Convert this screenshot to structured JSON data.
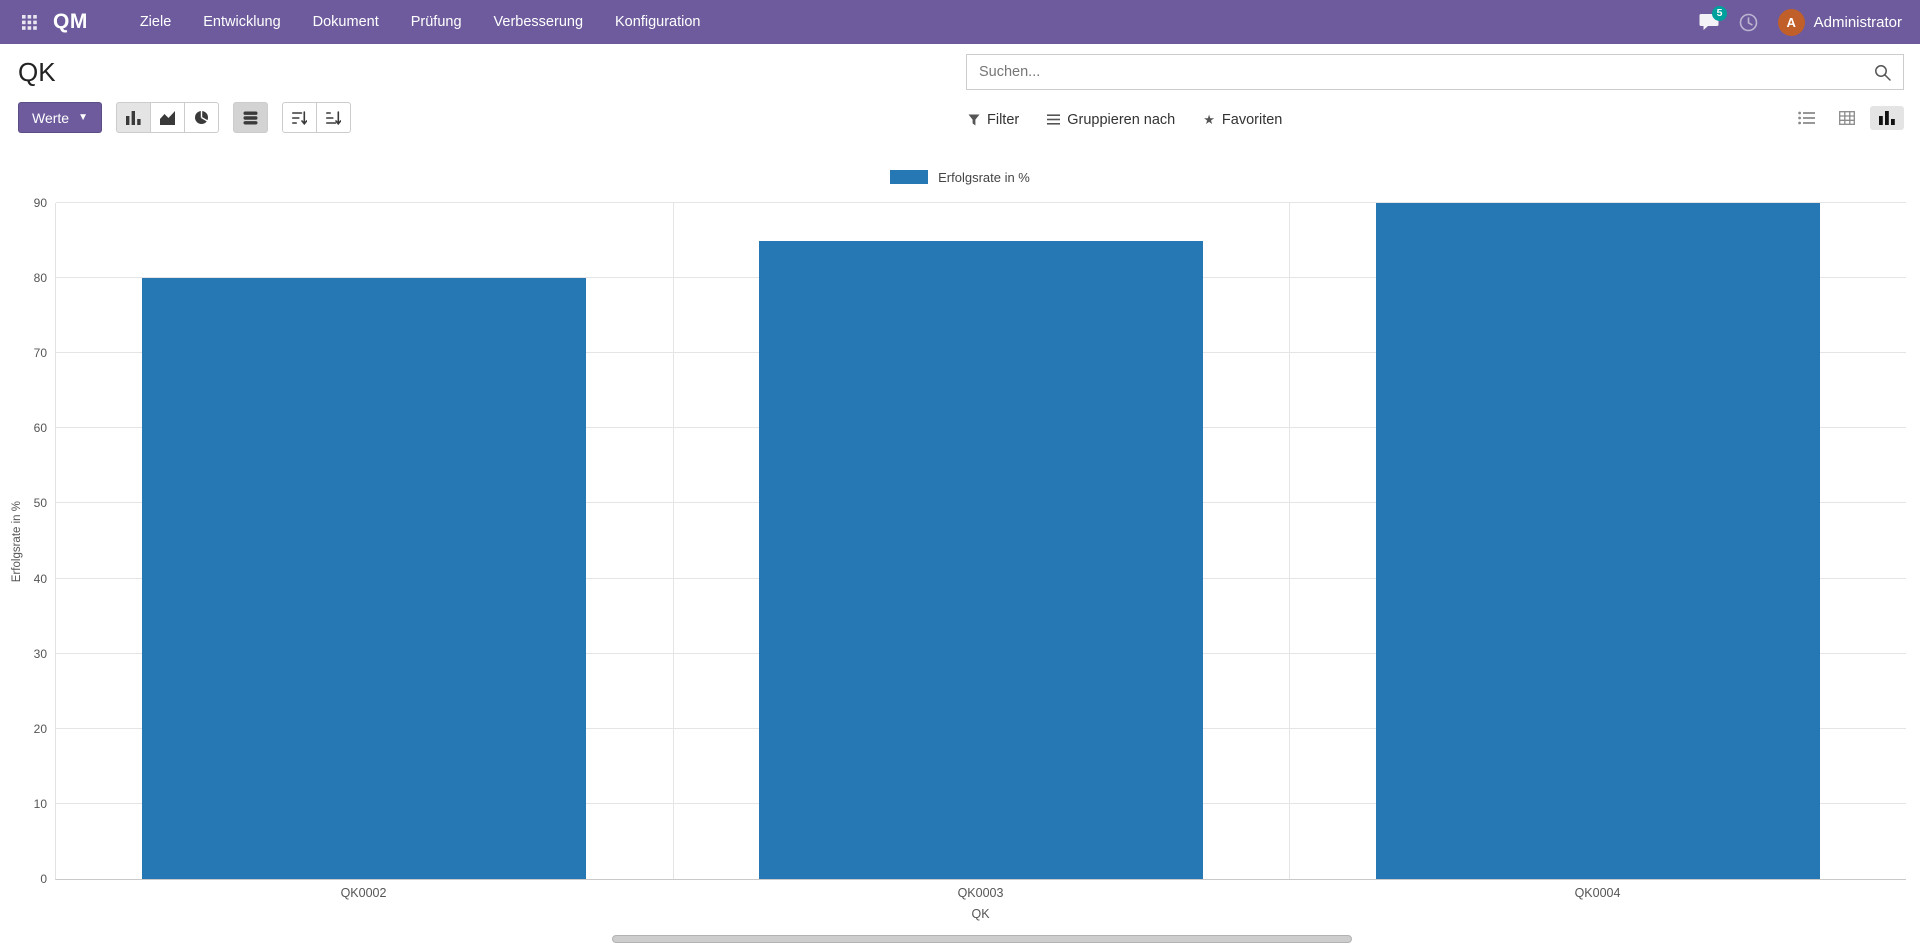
{
  "theme": {
    "navbar_bg": "#6d5b9d",
    "badge_color": "#00a09d",
    "avatar_color": "#c05f2a"
  },
  "navbar": {
    "brand": "QM",
    "menu_items": [
      "Ziele",
      "Entwicklung",
      "Dokument",
      "Prüfung",
      "Verbesserung",
      "Konfiguration"
    ],
    "messages_badge": "5",
    "user_name": "Administrator",
    "avatar_initial": "A"
  },
  "header": {
    "title": "QK",
    "search_placeholder": "Suchen..."
  },
  "toolbar": {
    "measures_label": "Werte",
    "filter_label": "Filter",
    "groupby_label": "Gruppieren nach",
    "favorites_label": "Favoriten"
  },
  "chart_data": {
    "type": "bar",
    "categories": [
      "QK0002",
      "QK0003",
      "QK0004"
    ],
    "series": [
      {
        "name": "Erfolgsrate in %",
        "values": [
          80,
          85,
          90
        ]
      }
    ],
    "title": "",
    "xlabel": "QK",
    "ylabel": "Erfolgsrate in %",
    "ylim": [
      0,
      90
    ],
    "ytick_step": 10,
    "grid": true,
    "legend_position": "top",
    "color": "#2678b5"
  }
}
